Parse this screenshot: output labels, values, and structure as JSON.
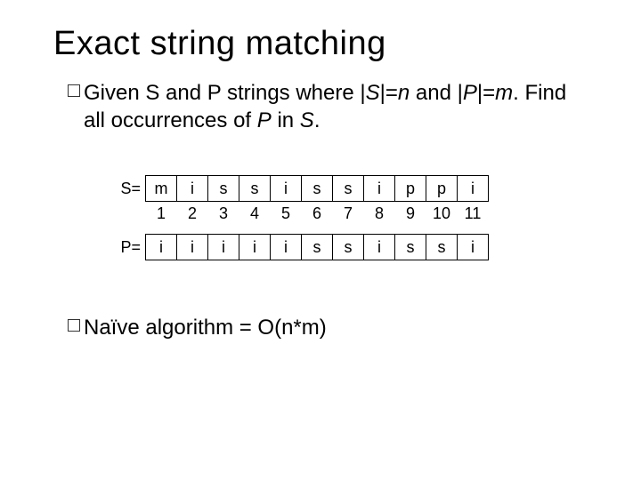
{
  "title": "Exact string matching",
  "bullets": {
    "b1": {
      "p1": "Given S and P strings where |",
      "s": "S",
      "p2": "|=",
      "n": "n",
      "p3": " and |",
      "p_letter": "P",
      "p4": "|=",
      "m": "m",
      "p5": ". Find all occurrences of ",
      "p6": " in ",
      "s2": "S",
      "p7": "."
    },
    "b2": {
      "t": "Naïve algorithm = O(n*m)"
    }
  },
  "labels": {
    "S": "S=",
    "P": "P="
  },
  "chart_data": {
    "type": "table",
    "S_string": [
      "m",
      "i",
      "s",
      "s",
      "i",
      "s",
      "s",
      "i",
      "p",
      "p",
      "i"
    ],
    "indices": [
      "1",
      "2",
      "3",
      "4",
      "5",
      "6",
      "7",
      "8",
      "9",
      "10",
      "11"
    ],
    "P_string": [
      "i",
      "i",
      "i",
      "i",
      "i",
      "s",
      "s",
      "i",
      "s",
      "s",
      "i"
    ]
  }
}
